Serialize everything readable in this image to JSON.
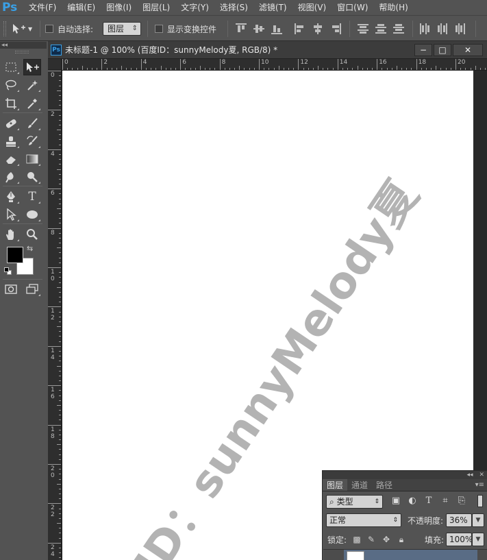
{
  "app": {
    "logo": "Ps"
  },
  "menu": [
    "文件(F)",
    "编辑(E)",
    "图像(I)",
    "图层(L)",
    "文字(Y)",
    "选择(S)",
    "滤镜(T)",
    "视图(V)",
    "窗口(W)",
    "帮助(H)"
  ],
  "options": {
    "auto_select_label": "自动选择:",
    "auto_select_value": "图层",
    "show_transform_label": "显示变换控件"
  },
  "document": {
    "icon": "Ps",
    "title": "未标题-1 @ 100% (百度ID：sunnyMelody夏, RGB/8) *",
    "minimize": "−",
    "maximize": "□",
    "close": "✕"
  },
  "ruler": {
    "top": [
      "0",
      "2",
      "4",
      "6",
      "8",
      "10",
      "12",
      "14",
      "16",
      "18",
      "20"
    ],
    "left": [
      "0",
      "2",
      "4",
      "6",
      "8",
      "10",
      "12",
      "14",
      "16",
      "18",
      "20",
      "22",
      "24"
    ]
  },
  "watermark": {
    "text": "ID：sunnyMelody夏",
    "color": "#b3b3b3"
  },
  "layers_panel": {
    "tabs": [
      "图层",
      "通道",
      "路径"
    ],
    "filter_label": "类型",
    "blend_mode": "正常",
    "opacity_label": "不透明度:",
    "opacity_value": "36%",
    "lock_label": "锁定:",
    "fill_label": "填充:",
    "fill_value": "100%"
  },
  "colors": {
    "foreground": "#000000",
    "background": "#ffffff",
    "accent": "#3aa0e6"
  }
}
